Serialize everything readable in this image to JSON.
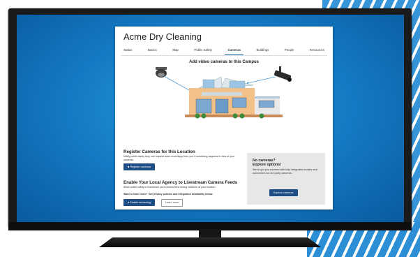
{
  "app": {
    "title": "Acme Dry Cleaning",
    "tabs": [
      {
        "label": "Status",
        "active": false
      },
      {
        "label": "Basics",
        "active": false
      },
      {
        "label": "Map",
        "active": false
      },
      {
        "label": "Public Safety",
        "active": false
      },
      {
        "label": "Cameras",
        "active": true
      },
      {
        "label": "Buildings",
        "active": false
      },
      {
        "label": "People",
        "active": false
      },
      {
        "label": "Resources",
        "active": false
      }
    ],
    "hero_title": "Add video cameras to this Campus",
    "register": {
      "title": "Register Cameras for this Location",
      "description": "Notify public safety they can request video recordings from you if something happens in view of your cameras.",
      "button": "Register cameras"
    },
    "livestream": {
      "title": "Enable Your Local Agency to Livestream Camera Feeds",
      "description": "Allow public safety to livestream your camera feed during incidents at your location.",
      "learn_more_text": "Want to learn more? See privacy policies and integration availability below.",
      "enable_button": "Enable streaming",
      "learn_more_button": "Learn more"
    },
    "no_cameras": {
      "title_line1": "No cameras?",
      "title_line2": "Explore options!",
      "description": "We've got you covered with fully integrated models and connectors for 3rd party cameras.",
      "button": "Explore cameras"
    }
  },
  "colors": {
    "accent": "#1e4d86",
    "screen_blue": "#1377c2",
    "stripe_blue": "#2c8fd6"
  }
}
